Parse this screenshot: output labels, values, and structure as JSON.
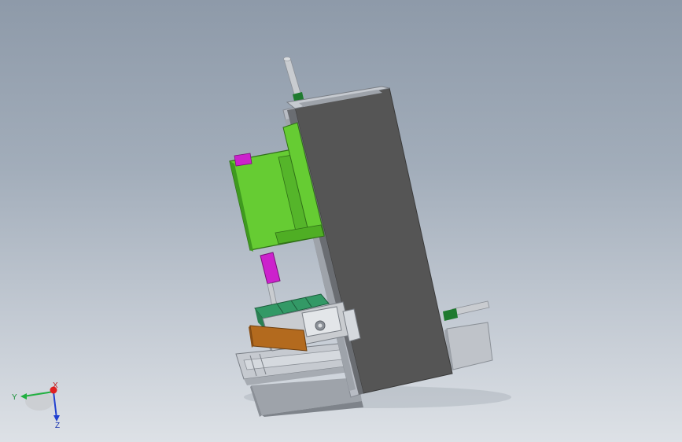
{
  "viewport": {
    "background_top": "#8e9aa9",
    "background_bottom": "#dde1e6"
  },
  "model": {
    "colors": {
      "column": "#555555",
      "column_edge": "#3a3a3a",
      "frame": "#b8bcc4",
      "housing": "#66cc33",
      "housing_dark": "#3f9a1f",
      "actuator": "#cc22cc",
      "block": "#339966",
      "wear_plate": "#b36a1e",
      "base": "#bfc3c9",
      "rod": "#c9ccd0",
      "collar": "#1f7a2f"
    },
    "parts": [
      "main-column",
      "side-frame",
      "top-cylinder",
      "motor-housing",
      "vertical-actuator",
      "workpiece-block",
      "clamp-vise",
      "wear-plate",
      "base-rail",
      "base-block",
      "right-foot",
      "side-cylinder"
    ]
  },
  "triad": {
    "x_label": "X",
    "y_label": "Y",
    "z_label": "Z",
    "colors": {
      "x": "#e02020",
      "y": "#20b040",
      "z": "#2040d0"
    }
  }
}
